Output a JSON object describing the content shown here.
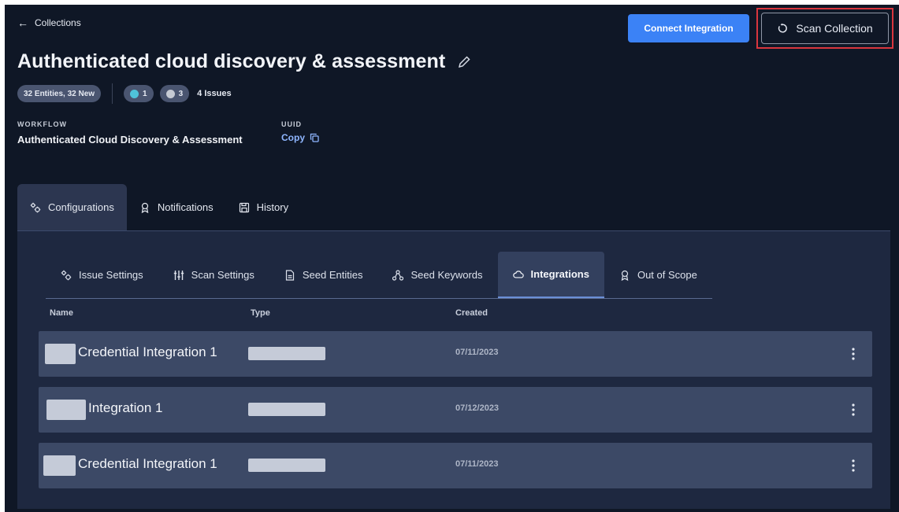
{
  "header": {
    "back_label": "Collections",
    "connect_button": "Connect Integration",
    "scan_button": "Scan Collection",
    "title": "Authenticated cloud discovery & assessment"
  },
  "meta": {
    "entities_pill": "32 Entities, 32 New",
    "severity_pills": [
      {
        "count": "1",
        "color": "#4fc3d9"
      },
      {
        "count": "3",
        "color": "#c5cad3"
      }
    ],
    "issues_text": "4 Issues"
  },
  "fields": {
    "workflow_label": "WORKFLOW",
    "workflow_value": "Authenticated Cloud Discovery & Assessment",
    "uuid_label": "UUID",
    "copy_label": "Copy"
  },
  "main_tabs": [
    {
      "label": "Configurations",
      "icon": "gears-icon",
      "active": true
    },
    {
      "label": "Notifications",
      "icon": "ribbon-icon",
      "active": false
    },
    {
      "label": "History",
      "icon": "save-icon",
      "active": false
    }
  ],
  "sub_tabs": [
    {
      "label": "Issue Settings",
      "icon": "gears-icon",
      "active": false
    },
    {
      "label": "Scan Settings",
      "icon": "sliders-icon",
      "active": false
    },
    {
      "label": "Seed Entities",
      "icon": "document-icon",
      "active": false
    },
    {
      "label": "Seed Keywords",
      "icon": "network-icon",
      "active": false
    },
    {
      "label": "Integrations",
      "icon": "cloud-icon",
      "active": true
    },
    {
      "label": "Out of Scope",
      "icon": "ribbon-icon",
      "active": false
    }
  ],
  "table": {
    "columns": [
      "Name",
      "Type",
      "Created"
    ],
    "rows": [
      {
        "name": "Credential Integration 1",
        "created": "07/11/2023"
      },
      {
        "name": "Integration 1",
        "created": "07/12/2023"
      },
      {
        "name": "Credential Integration 1",
        "created": "07/11/2023"
      }
    ]
  },
  "colors": {
    "background": "#0f1726",
    "panel": "#1e2840",
    "row": "#3c4966",
    "accent": "#3b82f6",
    "highlight": "#d9363e",
    "link": "#8fb6ff"
  }
}
